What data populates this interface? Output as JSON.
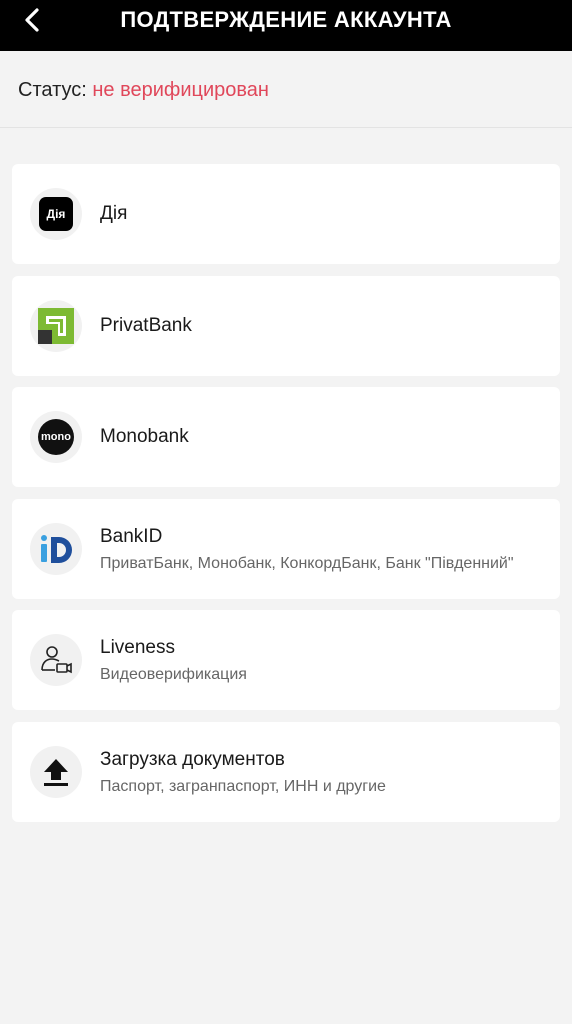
{
  "header": {
    "title": "ПОДТВЕРЖДЕНИЕ АККАУНТА",
    "back_icon": "chevron-left-icon"
  },
  "status": {
    "label": "Статус:",
    "value": "не верифицирован",
    "value_color": "#e0475a"
  },
  "options": [
    {
      "name": "Дія",
      "subtitle": "",
      "icon": "diia-logo",
      "icon_text": "Дія"
    },
    {
      "name": "PrivatBank",
      "subtitle": "",
      "icon": "privatbank-logo"
    },
    {
      "name": "Monobank",
      "subtitle": "",
      "icon": "monobank-logo",
      "icon_text": "mono"
    },
    {
      "name": "BankID",
      "subtitle": "ПриватБанк, Монобанк, КонкордБанк, Банк \"Південний\"",
      "icon": "bankid-logo"
    },
    {
      "name": "Liveness",
      "subtitle": "Видеоверификация",
      "icon": "user-video-icon"
    },
    {
      "name": "Загрузка документов",
      "subtitle": "Паспорт, загранпаспорт, ИНН и другие",
      "icon": "upload-icon"
    }
  ]
}
